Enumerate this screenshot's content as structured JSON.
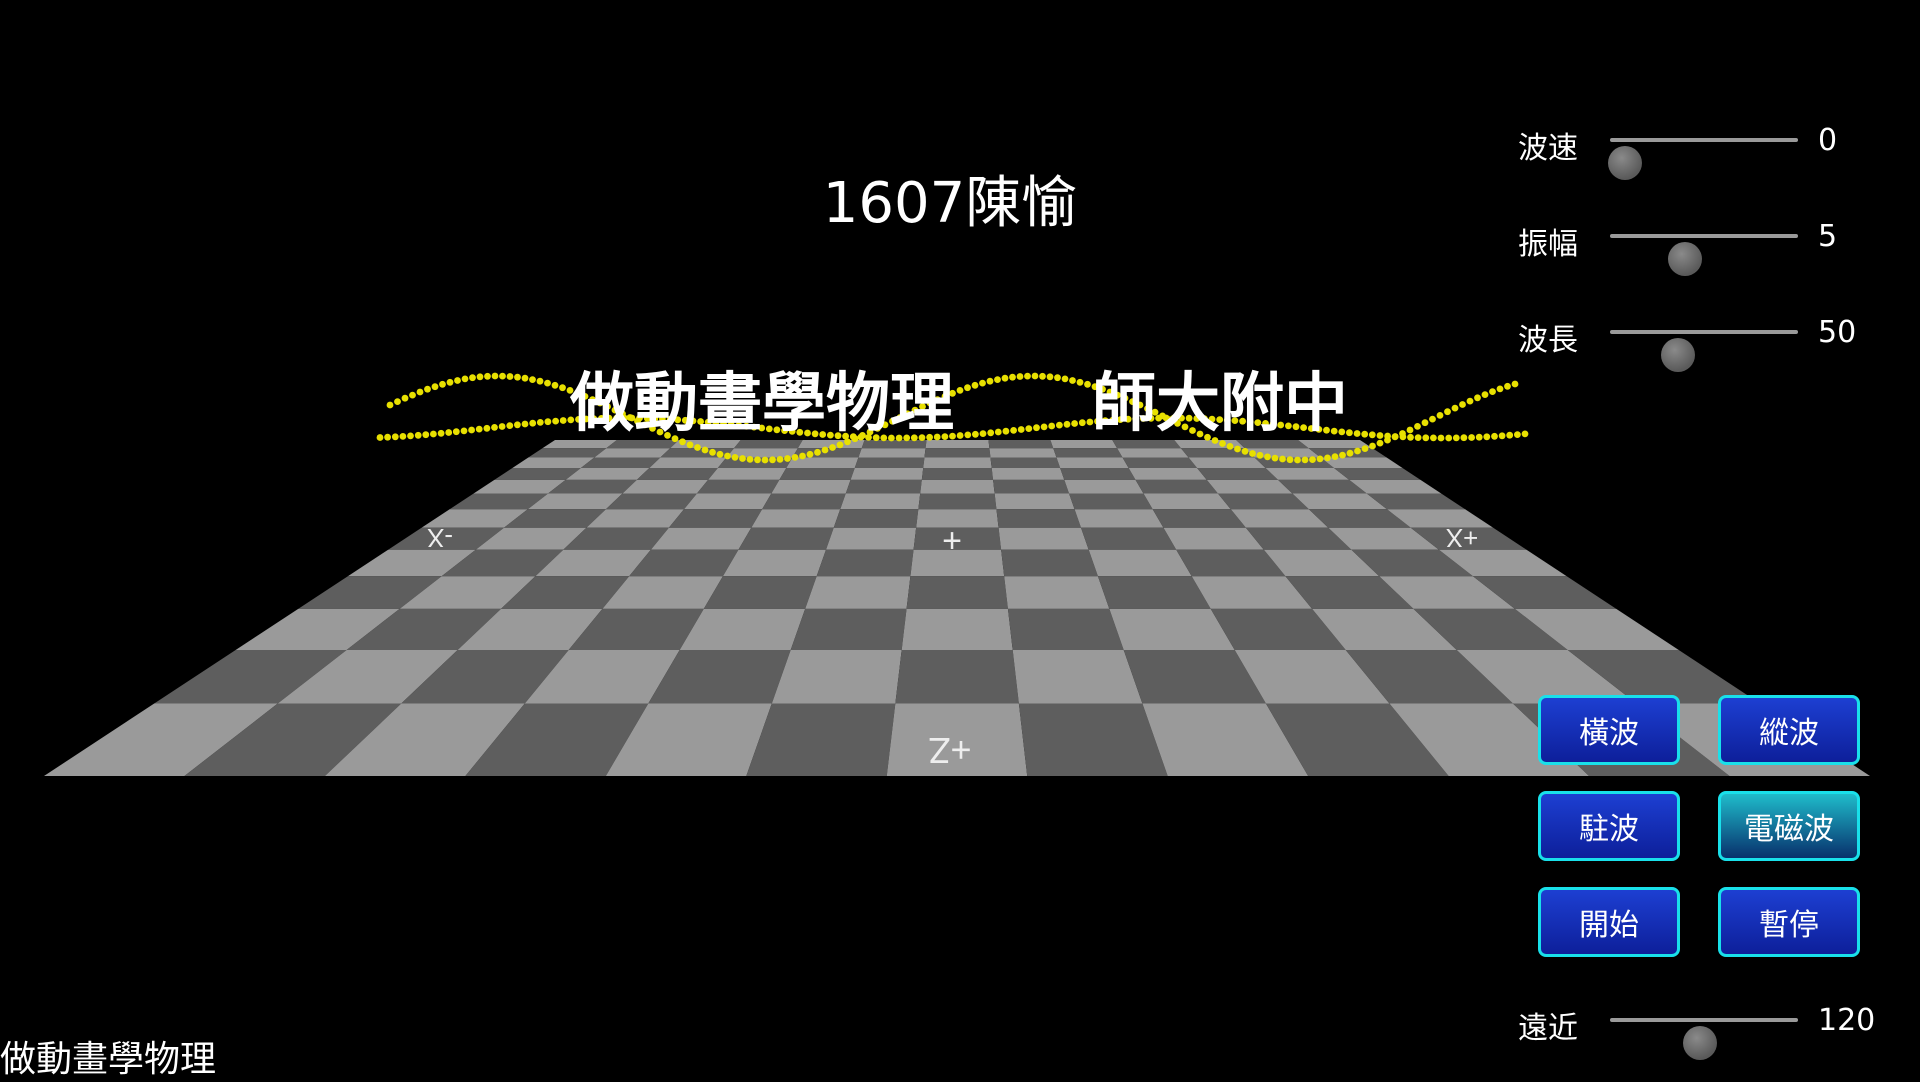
{
  "title": "1607陳愉",
  "banner": {
    "left": "做動畫學物理",
    "right": "師大附中"
  },
  "axis_labels": {
    "minus_x": "-X",
    "plus_x": "+X",
    "plus_z": "+Z"
  },
  "controls": {
    "wave_speed": {
      "label": "波速",
      "value": "0",
      "fraction": 0.08
    },
    "amplitude": {
      "label": "振幅",
      "value": "5",
      "fraction": 0.4
    },
    "wavelength": {
      "label": "波長",
      "value": "50",
      "fraction": 0.36
    },
    "distance": {
      "label": "遠近",
      "value": "120",
      "fraction": 0.48
    }
  },
  "buttons": {
    "transverse": "橫波",
    "longitudinal": "縱波",
    "standing": "駐波",
    "electromagnetic": "電磁波",
    "start": "開始",
    "pause": "暫停"
  },
  "footer": "做動畫學物理",
  "colors": {
    "wave": "#e8e000",
    "button_border": "#19e0ea",
    "board_light": "#9a9a9a",
    "board_dark": "#5e5e5e"
  }
}
